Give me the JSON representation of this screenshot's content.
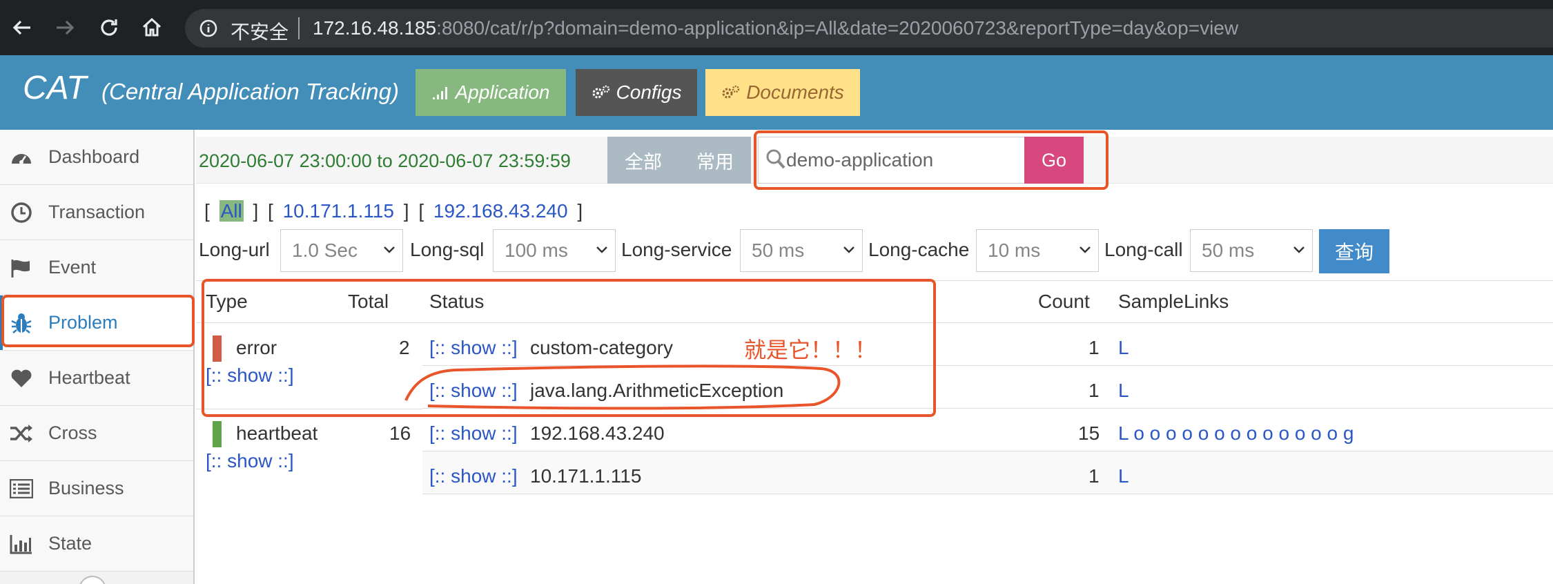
{
  "browser": {
    "insecure_label": "不安全",
    "url_host": "172.16.48.185",
    "url_rest": ":8080/cat/r/p?domain=demo-application&ip=All&date=2020060723&reportType=day&op=view"
  },
  "header": {
    "logo": "CAT",
    "subtitle": "(Central Application Tracking)",
    "buttons": {
      "application": "Application",
      "configs": "Configs",
      "documents": "Documents"
    },
    "colors": {
      "bar": "#438eb9",
      "application": "#87b87f",
      "configs": "#555555",
      "documents": "#fee188"
    }
  },
  "sidebar": {
    "items": [
      {
        "label": "Dashboard",
        "icon": "dashboard-icon"
      },
      {
        "label": "Transaction",
        "icon": "clock-icon"
      },
      {
        "label": "Event",
        "icon": "flag-icon"
      },
      {
        "label": "Problem",
        "icon": "bug-icon",
        "active": true
      },
      {
        "label": "Heartbeat",
        "icon": "heart-icon"
      },
      {
        "label": "Cross",
        "icon": "random-icon"
      },
      {
        "label": "Business",
        "icon": "list-icon"
      },
      {
        "label": "State",
        "icon": "bar-chart-icon"
      }
    ]
  },
  "toolbar": {
    "time_range": "2020-06-07 23:00:00 to 2020-06-07 23:59:59",
    "toggle_all": "全部",
    "toggle_common": "常用",
    "search_value": "demo-application",
    "go_label": "Go"
  },
  "ips": {
    "open": "[",
    "close": "]",
    "all": "All",
    "ip1": "10.171.1.115",
    "ip2": "192.168.43.240"
  },
  "filters": {
    "long_url": {
      "label": "Long-url",
      "value": "1.0 Sec"
    },
    "long_sql": {
      "label": "Long-sql",
      "value": "100 ms"
    },
    "long_service": {
      "label": "Long-service",
      "value": "50 ms"
    },
    "long_cache": {
      "label": "Long-cache",
      "value": "10 ms"
    },
    "long_call": {
      "label": "Long-call",
      "value": "50 ms"
    },
    "query_label": "查询"
  },
  "table": {
    "headers": {
      "type": "Type",
      "total": "Total",
      "status": "Status",
      "count": "Count",
      "samples": "SampleLinks"
    },
    "show_link": "[:: show ::]",
    "groups": [
      {
        "type": "error",
        "total": "2",
        "color": "#d15b47",
        "rows": [
          {
            "status": "custom-category",
            "count": "1",
            "samples": "L"
          },
          {
            "status": "java.lang.ArithmeticException",
            "count": "1",
            "samples": "L"
          }
        ]
      },
      {
        "type": "heartbeat",
        "total": "16",
        "color": "#5ea549",
        "rows": [
          {
            "status": "192.168.43.240",
            "count": "15",
            "samples": "L o o o o o o o o o o o o o g"
          },
          {
            "status": "10.171.1.115",
            "count": "1",
            "samples": "L"
          }
        ]
      }
    ]
  },
  "annotation": {
    "note": "就是它！！！",
    "color": "#e8552b"
  }
}
